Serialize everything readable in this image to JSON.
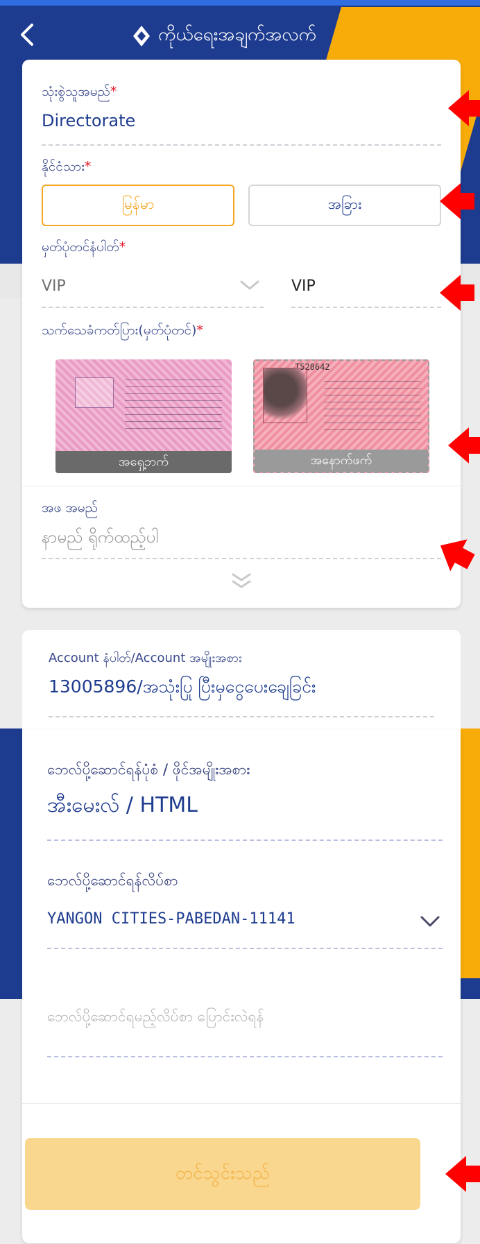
{
  "header": {
    "back_icon": "chevron-left-icon",
    "logo_icon": "diamond-logo-icon",
    "title": "ကိုယ်ရေးအချက်အလက်"
  },
  "profile": {
    "username_label": "သုံးစွဲသူအမည်",
    "username_value": "Directorate",
    "nationality_label": "နိုင်ငံသား",
    "nationality_options": [
      "မြန်မာ",
      "အခြား"
    ],
    "nationality_selected": "မြန်မာ",
    "id_number_label": "မှတ်ပုံတင်နံပါတ်",
    "id_prefix_value": "VIP",
    "id_number_value": "VIP",
    "id_card_label": "သက်သေခံကတ်ပြား(မှတ်ပုံတင်)",
    "id_front_caption": "အရှေ့ဘက်",
    "id_back_caption": "အနောက်ဖက်",
    "id_card_number": "T528642",
    "father_name_label": "အဖ အမည်",
    "father_name_placeholder": "နာမည် ရိုက်ထည့်ပါ",
    "required_mark": "*"
  },
  "account": {
    "label": "Account နံပါတ်/Account အမျိုးအစား",
    "value": "13005896/အသုံးပြု ပြီးမှငွေပေးချေခြင်း"
  },
  "billing": {
    "format_label": "ဘေလ်ပို့ဆောင်ရန်ပုံစံ / ဖိုင်အမျိုးအစား",
    "format_value": "အီးမေးလ် / HTML",
    "address_label": "ဘေလ်ပို့ဆောင်ရန်လိပ်စာ",
    "address_value": "YANGON CITIES-PABEDAN-11141",
    "change_address_placeholder": "ဘေလ်ပို့ဆောင်ရမည့်လိပ်စာ ပြောင်းလဲရန်"
  },
  "actions": {
    "submit_label": "တင်သွင်းသည်"
  },
  "colors": {
    "brand_blue": "#1e3c8f",
    "brand_yellow": "#f8ac0a",
    "accent_orange": "#f5a623",
    "required_red": "#e0192b",
    "annotation_red": "#ff0000"
  }
}
